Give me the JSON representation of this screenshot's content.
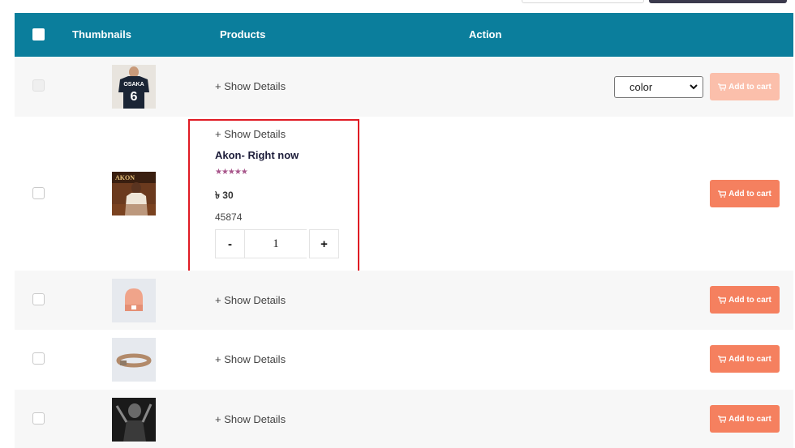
{
  "header": {
    "col_thumbnails": "Thumbnails",
    "col_products": "Products",
    "col_action": "Action"
  },
  "rows": [
    {
      "show_details": "+ Show Details",
      "select_value": "color",
      "cart_label": "Add to cart",
      "thumb": "shirt-osaka",
      "checkbox_disabled": true,
      "cart_disabled": true
    },
    {
      "show_details": "+ Show Details",
      "title": "Akon- Right now",
      "stars": "★★★★★",
      "rating": 5,
      "price": "৳ 30",
      "sku": "45874",
      "qty_minus": "-",
      "qty_value": "1",
      "qty_plus": "+",
      "cart_label": "Add to cart",
      "thumb": "akon-album"
    },
    {
      "show_details": "+ Show Details",
      "cart_label": "Add to cart",
      "thumb": "beanie"
    },
    {
      "show_details": "+ Show Details",
      "cart_label": "Add to cart",
      "thumb": "belt"
    },
    {
      "show_details": "+ Show Details",
      "cart_label": "Add to cart",
      "thumb": "album-portrait"
    }
  ],
  "colors": {
    "header_bg": "#0b7e9c",
    "cart_button": "#f5805f",
    "highlight_border": "#e01b24",
    "star": "#a8568b"
  }
}
